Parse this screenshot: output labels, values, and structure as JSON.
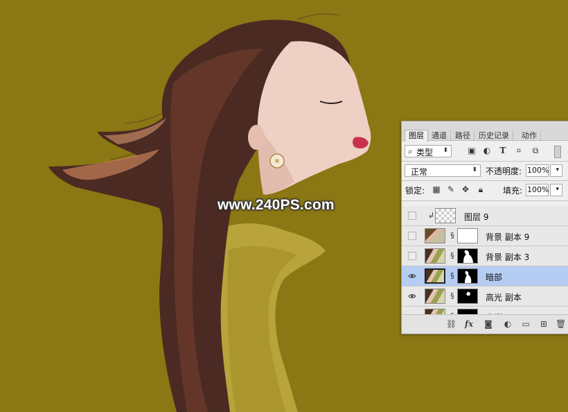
{
  "canvas": {
    "background_color": "#8b7713",
    "watermark": "www.240PS.com"
  },
  "panel": {
    "tabs": [
      {
        "label": "图层",
        "active": true
      },
      {
        "label": "通道",
        "active": false
      },
      {
        "label": "路径",
        "active": false
      },
      {
        "label": "历史记录",
        "active": false
      },
      {
        "label": "动作",
        "active": false
      }
    ],
    "filter": {
      "value": "类型",
      "icon": "search-icon"
    },
    "blend_mode": "正常",
    "opacity_label": "不透明度:",
    "opacity_value": "100%",
    "lock_label": "锁定:",
    "fill_label": "填充:",
    "fill_value": "100%",
    "layers": [
      {
        "name": "图层 9",
        "visible": false,
        "selected": false
      },
      {
        "name": "背景 副本 9",
        "visible": false,
        "selected": false
      },
      {
        "name": "背景 副本 3",
        "visible": false,
        "selected": false
      },
      {
        "name": "暗部",
        "visible": true,
        "selected": true
      },
      {
        "name": "高光 副本",
        "visible": true,
        "selected": false
      },
      {
        "name": "高光",
        "visible": true,
        "selected": false
      }
    ],
    "selected_color": "#b5cdf3"
  }
}
